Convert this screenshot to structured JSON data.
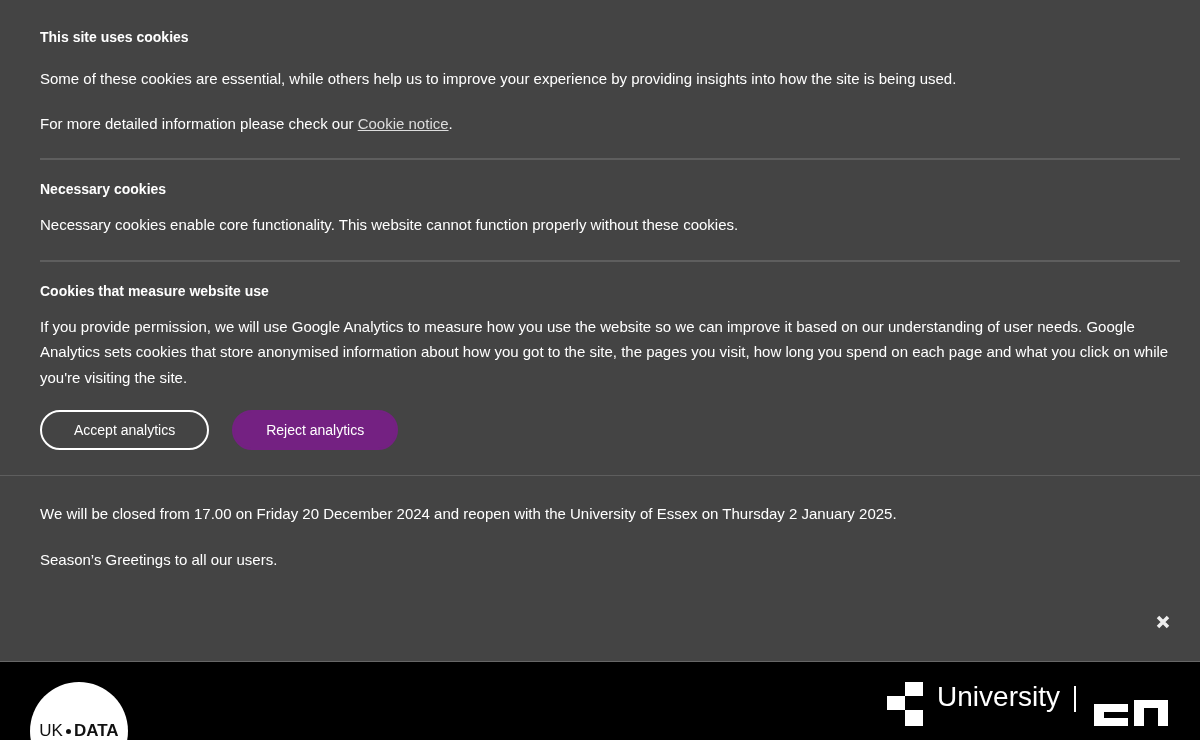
{
  "cookie_banner": {
    "title": "This site uses cookies",
    "intro": "Some of these cookies are essential, while others help us to improve your experience by providing insights into how the site is being used.",
    "notice_prefix": "For more detailed information please check our ",
    "notice_link": "Cookie notice",
    "notice_suffix": ".",
    "sections": [
      {
        "heading": "Necessary cookies",
        "text": "Necessary cookies enable core functionality. This website cannot function properly without these cookies."
      },
      {
        "heading": "Cookies that measure website use",
        "text": "If you provide permission, we will use Google Analytics to measure how you use the website so we can improve it based on our understanding of user needs. Google Analytics sets cookies that store anonymised information about how you got to the site, the pages you visit, how long you spend on each page and what you click on while you're visiting the site."
      }
    ],
    "buttons": [
      {
        "label": "Accept analytics",
        "selected": false
      },
      {
        "label": "Reject analytics",
        "selected": true
      }
    ]
  },
  "notice": {
    "lines": [
      "We will be closed from 17.00 on Friday 20 December 2024 and reopen with the University of Essex on Thursday 2 January 2025.",
      "Season’s Greetings to all our users."
    ]
  },
  "footer": {
    "logo_left": "UK",
    "logo_right": "DATA",
    "university": "University"
  }
}
